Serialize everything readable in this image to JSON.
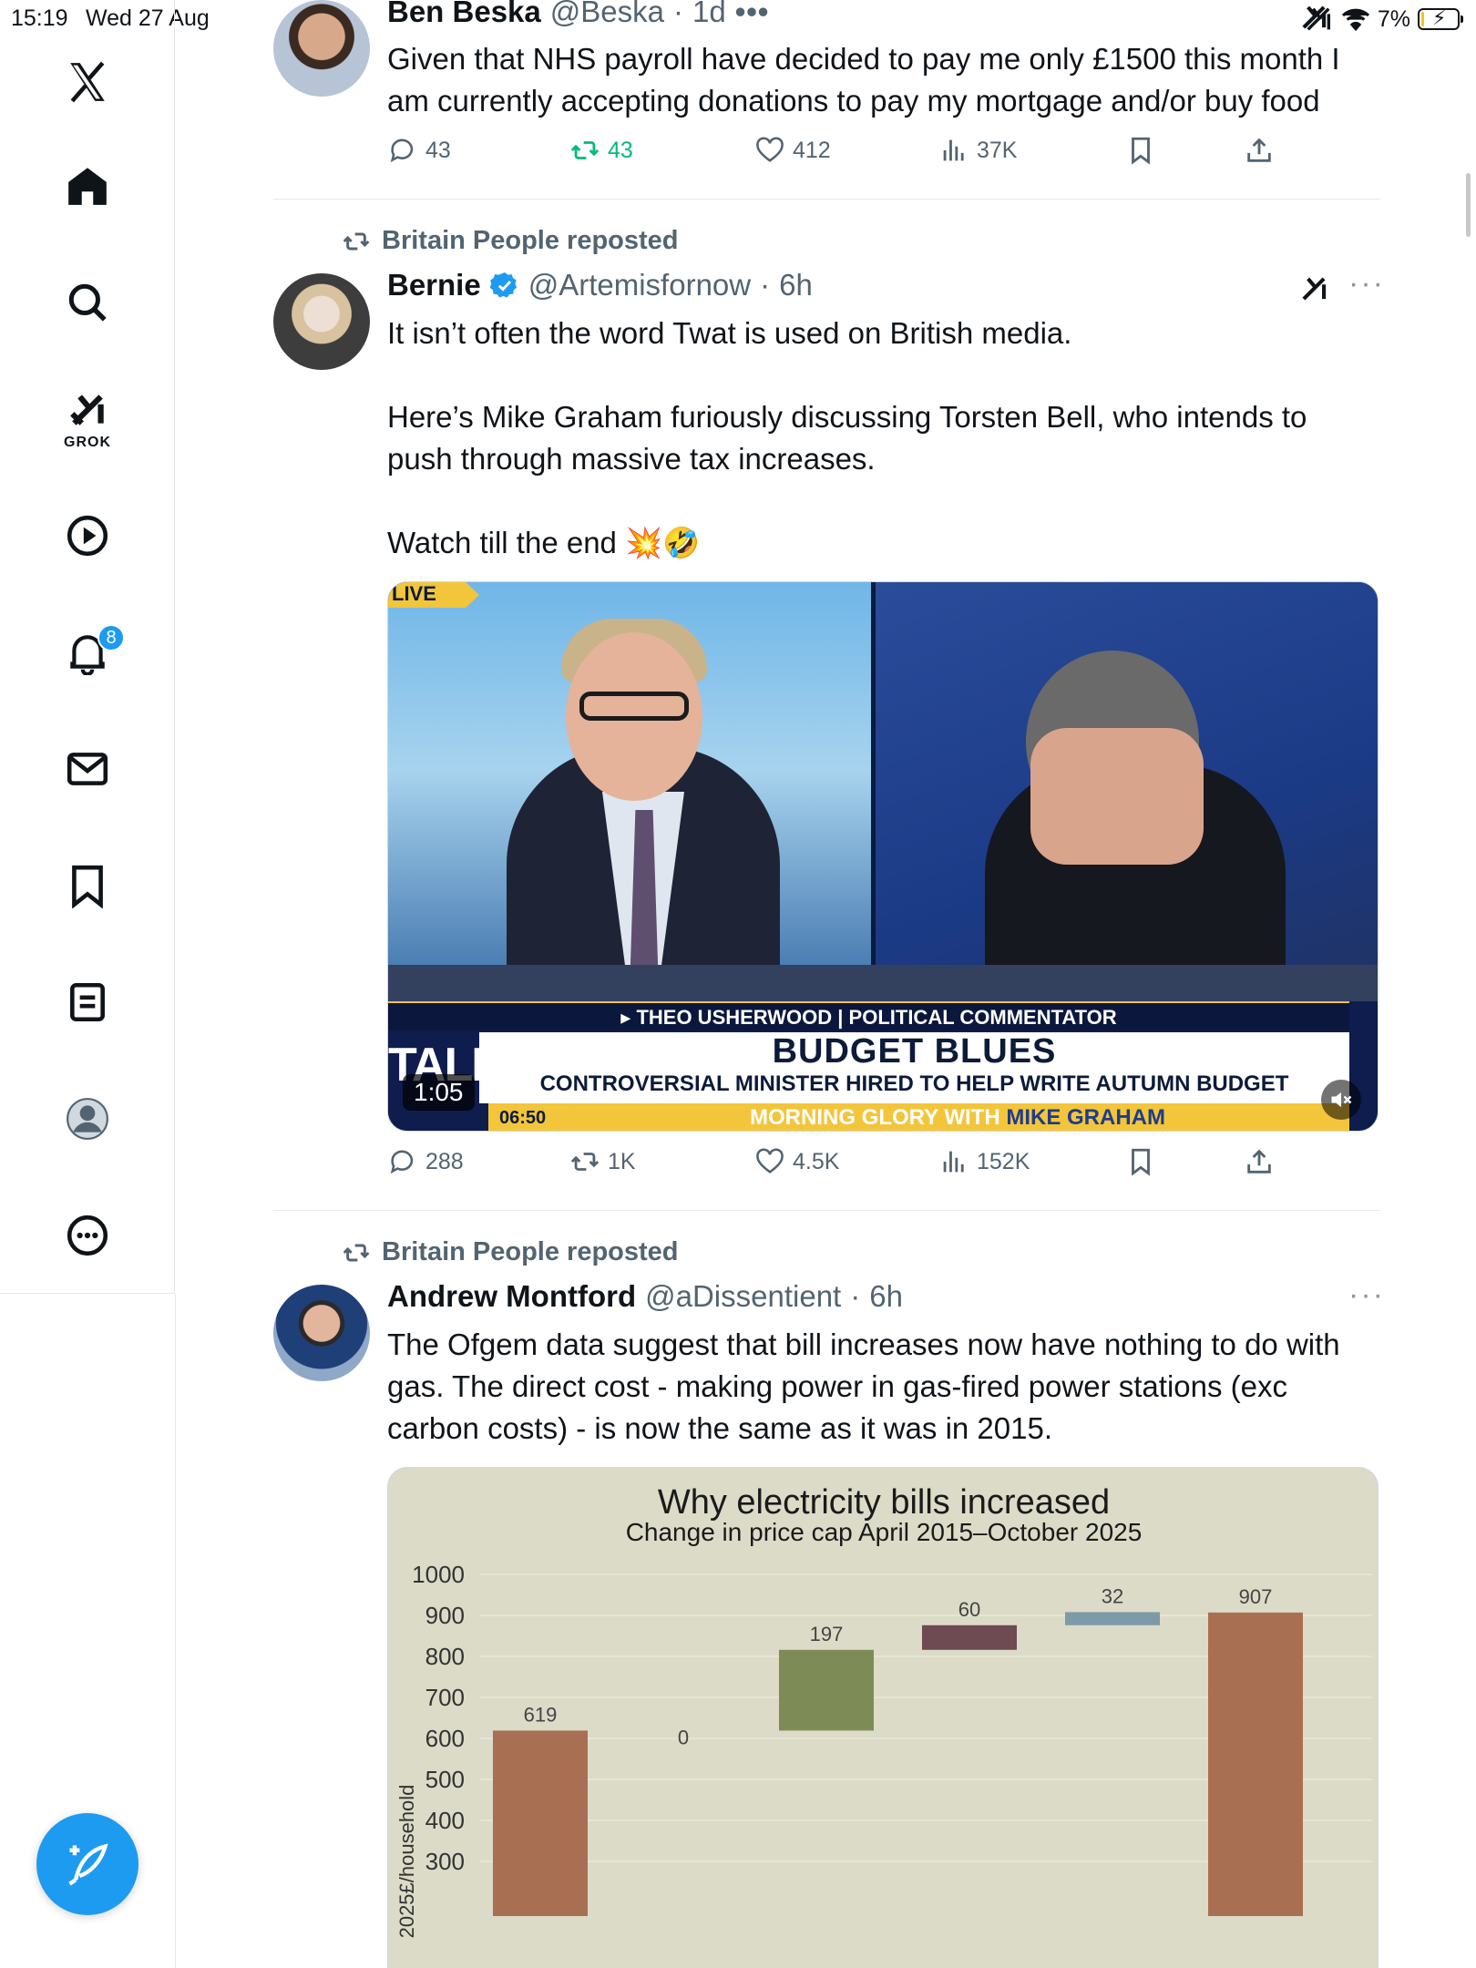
{
  "status_bar": {
    "time": "15:19",
    "date": "Wed 27 Aug",
    "battery": "7%",
    "battery_level": 0.07
  },
  "sidebar": {
    "items": [
      {
        "name": "x-logo-icon"
      },
      {
        "name": "home-icon"
      },
      {
        "name": "search-icon"
      },
      {
        "name": "grok-icon",
        "label": "GROK"
      },
      {
        "name": "video-icon"
      },
      {
        "name": "notifications-icon",
        "badge": "8"
      },
      {
        "name": "messages-icon"
      },
      {
        "name": "bookmarks-icon"
      },
      {
        "name": "lists-icon"
      },
      {
        "name": "profile-icon"
      },
      {
        "name": "more-icon"
      }
    ],
    "compose_icon": "compose-icon"
  },
  "tweets": [
    {
      "display_name": "Ben Beska",
      "handle": "@Beska",
      "time": "1d",
      "text": "Given that NHS payroll have decided to pay me only £1500 this month I am currently accepting donations to pay my mortgage and/or buy food",
      "replies": "43",
      "reposts": "43",
      "likes": "412",
      "views": "37K",
      "reposted": true
    },
    {
      "repost_label": "Britain People reposted",
      "display_name": "Bernie",
      "verified": true,
      "handle": "@Artemisfornow",
      "time": "6h",
      "text": "It isn’t often the word Twat is used on British media.\n\nHere’s Mike Graham furiously discussing Torsten Bell, who intends to push through massive tax increases.\n\nWatch till the end 💥🤣",
      "video": {
        "live_tag": "LIVE",
        "commentator": "▸ THEO USHERWOOD | POLITICAL COMMENTATOR",
        "headline": "BUDGET BLUES",
        "subheadline": "CONTROVERSIAL MINISTER HIRED TO HELP WRITE AUTUMN BUDGET",
        "channel": "TALK",
        "clock": "06:50",
        "show": "MORNING GLORY WITH ",
        "host": "MIKE GRAHAM",
        "duration": "1:05"
      },
      "replies": "288",
      "reposts": "1K",
      "likes": "4.5K",
      "views": "152K"
    },
    {
      "repost_label": "Britain People reposted",
      "display_name": "Andrew Montford",
      "handle": "@aDissentient",
      "time": "6h",
      "text": "The Ofgem data suggest that bill increases now have nothing to do with gas. The direct cost - making power in gas-fired power stations (exc carbon costs) - is now the same as it was in 2015."
    }
  ],
  "chart_data": {
    "type": "bar",
    "subtype": "waterfall",
    "title": "Why electricity bills increased",
    "subtitle": "Change in price cap April 2015–October 2025",
    "ylabel": "2025£/household",
    "ylim": [
      300,
      1000
    ],
    "yticks": [
      1000,
      900,
      800,
      700,
      600,
      500,
      400,
      300
    ],
    "bars": [
      {
        "base": 0,
        "top": 619,
        "label": "619",
        "color": "#a86f52"
      },
      {
        "base": 619,
        "top": 619,
        "label": "0",
        "color": "#6f7f46"
      },
      {
        "base": 619,
        "top": 816,
        "label": "197",
        "color": "#7d8c56"
      },
      {
        "base": 816,
        "top": 876,
        "label": "60",
        "color": "#6e4a52"
      },
      {
        "base": 876,
        "top": 908,
        "label": "32",
        "color": "#7d9aa8"
      },
      {
        "base": 0,
        "top": 907,
        "label": "907",
        "color": "#a86f52"
      }
    ],
    "background": "#dcdbc7"
  }
}
